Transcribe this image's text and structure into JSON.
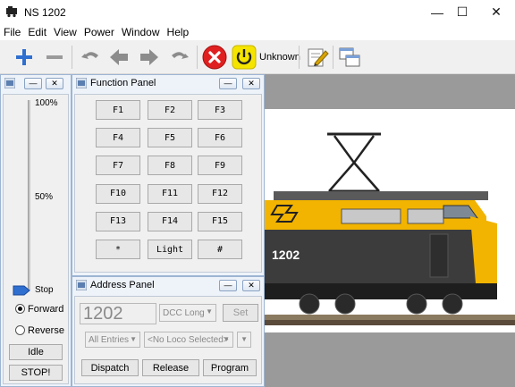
{
  "window": {
    "title": "NS 1202",
    "minimize_glyph": "—",
    "maximize_glyph": "☐",
    "close_glyph": "✕"
  },
  "menu": [
    "File",
    "Edit",
    "View",
    "Power",
    "Window",
    "Help"
  ],
  "toolbar": {
    "power_status": "Unknown",
    "icons": [
      "add-icon",
      "remove-icon",
      "undo-icon",
      "back-icon",
      "forward-icon",
      "redo-icon",
      "stop-icon",
      "power-icon",
      "edit-icon",
      "windows-icon"
    ]
  },
  "throttle_panel": {
    "speed_labels": {
      "max": "100%",
      "mid": "50%",
      "stop": "Stop"
    },
    "speed_level": 0,
    "direction_forward": "Forward",
    "direction_reverse": "Reverse",
    "direction_selected": "forward",
    "idle_label": "Idle",
    "estop_label": "STOP!"
  },
  "function_panel": {
    "title": "Function Panel",
    "buttons": [
      "F1",
      "F2",
      "F3",
      "F4",
      "F5",
      "F6",
      "F7",
      "F8",
      "F9",
      "F10",
      "F11",
      "F12",
      "F13",
      "F14",
      "F15",
      "*",
      "Light",
      "#"
    ]
  },
  "address_panel": {
    "title": "Address Panel",
    "address_value": "1202",
    "address_type": "DCC Long",
    "set_label": "Set",
    "roster_filter": "All Entries",
    "roster_selected": "<No Loco Selected>",
    "dispatch_label": "Dispatch",
    "release_label": "Release",
    "program_label": "Program"
  },
  "photo": {
    "loco_number": "1202"
  },
  "colors": {
    "loco_yellow": "#f2b400",
    "loco_grey": "#3c3c3c",
    "stop_red": "#e02020",
    "power_yellow": "#f5e400",
    "accent_blue": "#2f6fd0"
  }
}
